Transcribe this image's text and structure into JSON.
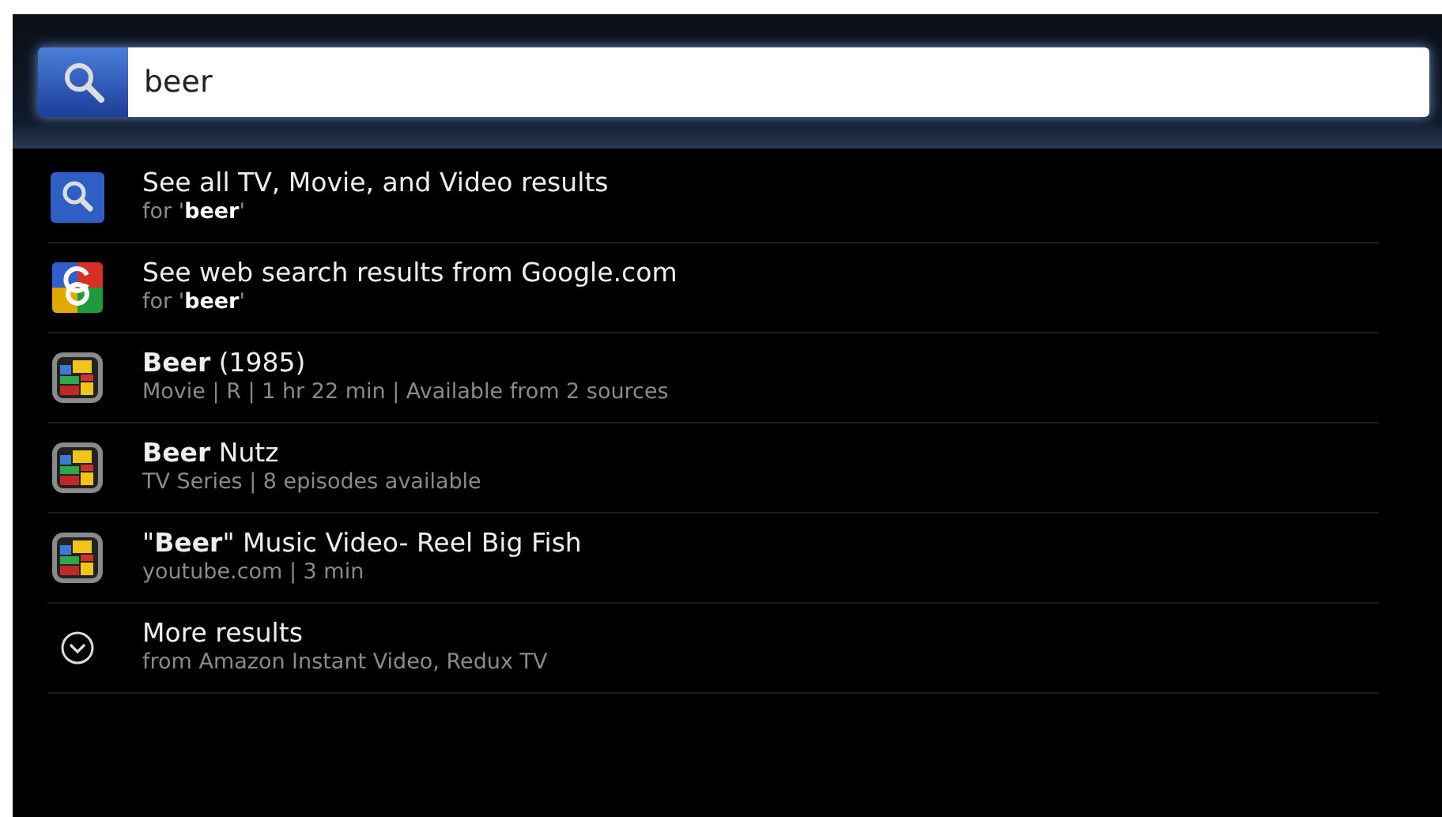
{
  "search": {
    "value": "beer"
  },
  "results": [
    {
      "kind": "search",
      "title": "See all TV, Movie, and Video results",
      "subtitle": "for '**beer**'"
    },
    {
      "kind": "google",
      "title": "See web search results from Google.com",
      "subtitle": "for '**beer**'"
    },
    {
      "kind": "app",
      "title": "**Beer** (1985)",
      "subtitle": "Movie | R | 1 hr 22 min | Available from 2 sources"
    },
    {
      "kind": "app",
      "title": "**Beer** Nutz",
      "subtitle": "TV Series | 8 episodes available"
    },
    {
      "kind": "app",
      "title": "\"**Beer**\" Music Video- Reel Big Fish",
      "subtitle": "youtube.com | 3 min"
    },
    {
      "kind": "more",
      "title": "More results",
      "subtitle": "from Amazon Instant Video, Redux TV"
    }
  ]
}
